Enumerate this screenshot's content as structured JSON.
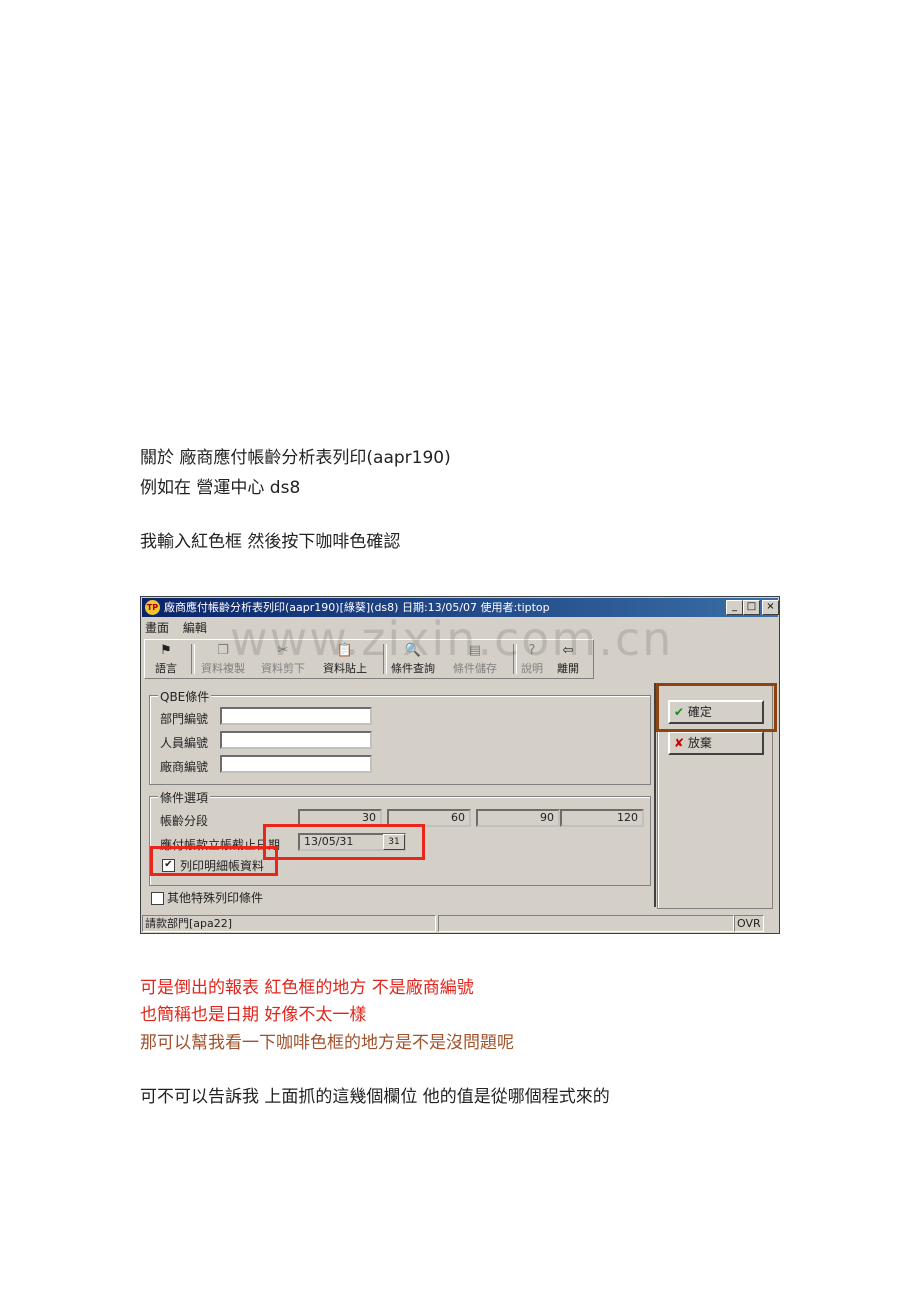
{
  "text": {
    "line1": "關於  廠商應付帳齡分析表列印(aapr190)",
    "line2": "例如在  營運中心 ds8",
    "line3": "我輸入紅色框  然後按下咖啡色確認",
    "line4": "可是倒出的報表  紅色框的地方  不是廠商編號",
    "line5": "也簡稱也是日期  好像不太一樣",
    "line6": "那可以幫我看一下咖啡色框的地方是不是沒問題呢",
    "line7": "可不可以告訴我  上面抓的這幾個欄位  他的值是從哪個程式來的"
  },
  "watermark": "www.zixin.com.cn",
  "window": {
    "title": "廠商應付帳齡分析表列印(aapr190)[綠葵](ds8) 日期:13/05/07 使用者:tiptop",
    "icon_label": "TP",
    "controls": [
      "_",
      "□",
      "×"
    ],
    "menu": [
      "畫面",
      "編輯"
    ],
    "toolbar": [
      {
        "label": "語言",
        "icon": "flag-icon",
        "glyph": "⚑"
      },
      {
        "label": "資料複製",
        "icon": "copy-icon",
        "glyph": "❐"
      },
      {
        "label": "資料剪下",
        "icon": "scissors-icon",
        "glyph": "✂"
      },
      {
        "label": "資料貼上",
        "icon": "paste-icon",
        "glyph": "📋"
      },
      {
        "label": "條件查詢",
        "icon": "query-icon",
        "glyph": "🔍"
      },
      {
        "label": "條件儲存",
        "icon": "save-icon",
        "glyph": "▤"
      },
      {
        "label": "說明",
        "icon": "help-icon",
        "glyph": "?"
      },
      {
        "label": "離開",
        "icon": "exit-icon",
        "glyph": "⇦"
      }
    ],
    "qbe": {
      "legend": "QBE條件",
      "fields": [
        {
          "label": "部門編號",
          "value": ""
        },
        {
          "label": "人員編號",
          "value": ""
        },
        {
          "label": "廠商編號",
          "value": ""
        }
      ]
    },
    "options": {
      "legend": "條件選項",
      "aging_label": "帳齡分段",
      "aging": [
        "30",
        "60",
        "90",
        "120"
      ],
      "cutoff_label": "應付帳款立帳截止日期",
      "cutoff_value": "13/05/31",
      "calendar_glyph": "31",
      "detail_label": "列印明細帳資料",
      "detail_checked": "✔"
    },
    "other_label": "其他特殊列印條件",
    "buttons": {
      "ok": {
        "label": "確定",
        "glyph": "✔"
      },
      "cancel": {
        "label": "放棄",
        "glyph": "✘"
      }
    },
    "status": {
      "left": "請款部門[apa22]",
      "mode": "OVR"
    }
  }
}
